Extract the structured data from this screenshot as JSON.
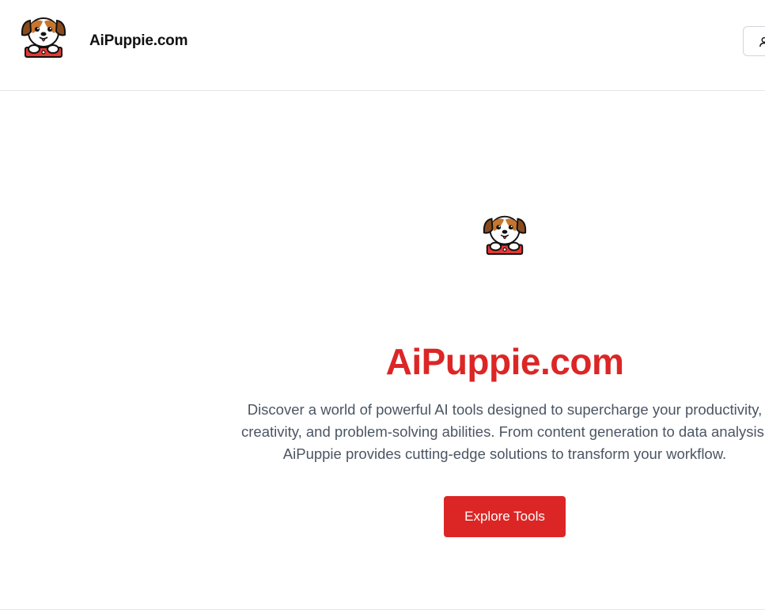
{
  "header": {
    "brand": "AiPuppie.com",
    "logo_icon": "puppy-logo-icon",
    "user_icon": "user-icon"
  },
  "hero": {
    "logo_icon": "puppy-logo-icon",
    "title": "AiPuppie.com",
    "description_lines": [
      "Discover a world of powerful AI tools designed to supercharge your productivity,",
      "creativity, and problem-solving abilities. From content generation to data analysis,",
      "AiPuppie provides cutting-edge solutions to transform your workflow."
    ],
    "cta_label": "Explore Tools"
  },
  "colors": {
    "accent": "#dc2626",
    "text": "#111111",
    "muted": "#4b5563",
    "border": "#e5e7eb"
  }
}
